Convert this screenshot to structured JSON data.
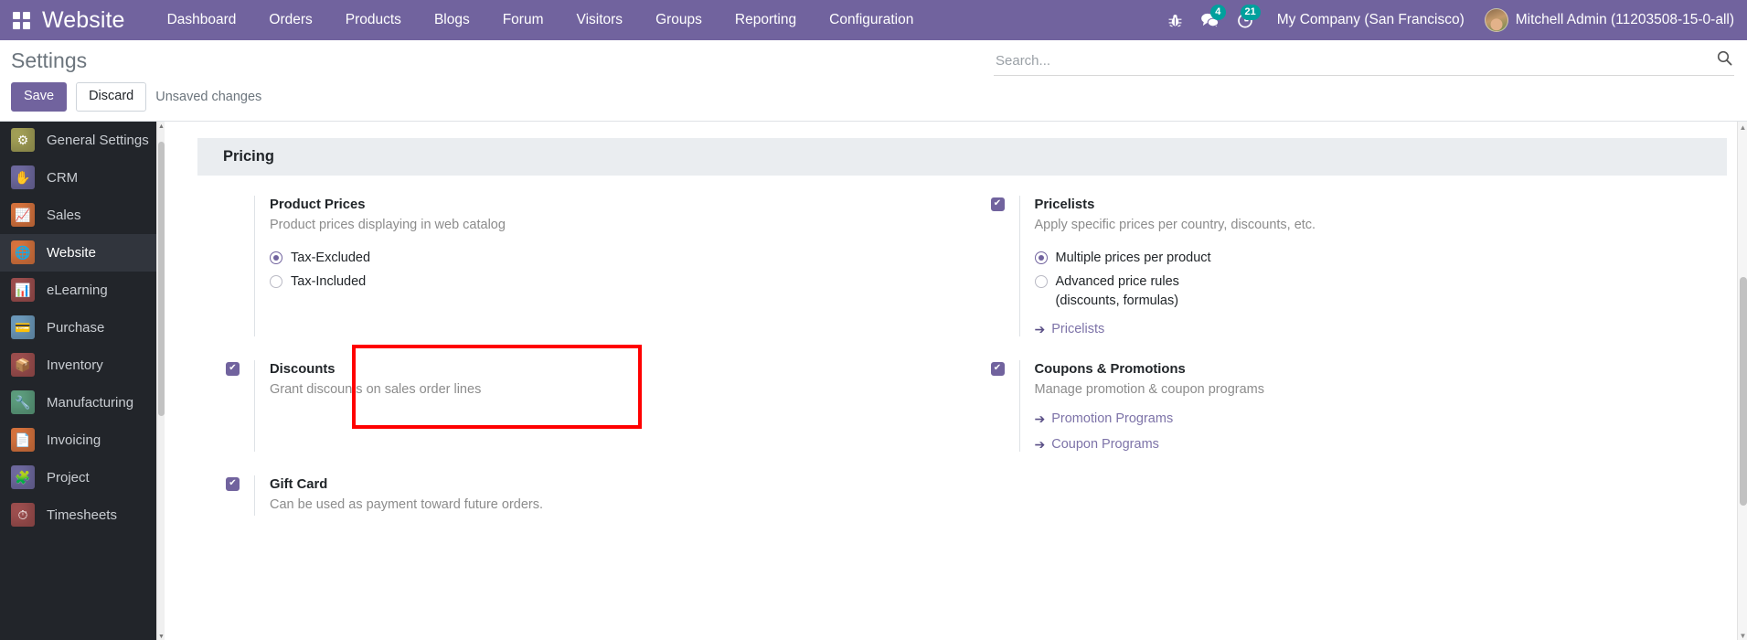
{
  "topbar": {
    "apps_icon": "apps-grid-icon",
    "brand": "Website",
    "menu": [
      {
        "label": "Dashboard"
      },
      {
        "label": "Orders"
      },
      {
        "label": "Products"
      },
      {
        "label": "Blogs"
      },
      {
        "label": "Forum"
      },
      {
        "label": "Visitors"
      },
      {
        "label": "Groups"
      },
      {
        "label": "Reporting"
      },
      {
        "label": "Configuration"
      }
    ],
    "sys_icons": [
      {
        "name": "bug-icon",
        "glyph": "🐞",
        "badge": ""
      },
      {
        "name": "messages-icon",
        "glyph": "💬",
        "badge": "4"
      },
      {
        "name": "activities-clock-icon",
        "glyph": "⏱",
        "badge": "21"
      }
    ],
    "company": "My Company (San Francisco)",
    "user": "Mitchell Admin (11203508-15-0-all)",
    "accent_color": "#71639e",
    "badge_color": "#00a09d"
  },
  "controlpanel": {
    "title": "Settings",
    "save_label": "Save",
    "discard_label": "Discard",
    "unsaved_label": "Unsaved changes",
    "search_placeholder": "Search...",
    "search_value": "",
    "search_icon": "search-icon"
  },
  "sidebar": {
    "items": [
      {
        "label": "General Settings",
        "icon": "gear-icon",
        "glyph": "⚙",
        "color": "#a3a057",
        "active": false
      },
      {
        "label": "CRM",
        "icon": "handshake-icon",
        "glyph": "✋",
        "color": "#6f6aa0",
        "active": false
      },
      {
        "label": "Sales",
        "icon": "chart-line-icon",
        "glyph": "📈",
        "color": "#d8743e",
        "active": false
      },
      {
        "label": "Website",
        "icon": "globe-icon",
        "glyph": "🌐",
        "color": "#d8743e",
        "active": true
      },
      {
        "label": "eLearning",
        "icon": "presentation-icon",
        "glyph": "📊",
        "color": "#9e4f4f",
        "active": false
      },
      {
        "label": "Purchase",
        "icon": "card-icon",
        "glyph": "💳",
        "color": "#6d9bbd",
        "active": false
      },
      {
        "label": "Inventory",
        "icon": "box-icon",
        "glyph": "📦",
        "color": "#9e4f4f",
        "active": false
      },
      {
        "label": "Manufacturing",
        "icon": "wrench-icon",
        "glyph": "🔧",
        "color": "#5d9e7e",
        "active": false
      },
      {
        "label": "Invoicing",
        "icon": "invoice-icon",
        "glyph": "📄",
        "color": "#d8743e",
        "active": false
      },
      {
        "label": "Project",
        "icon": "puzzle-icon",
        "glyph": "🧩",
        "color": "#6f6aa0",
        "active": false
      },
      {
        "label": "Timesheets",
        "icon": "stopwatch-icon",
        "glyph": "⏱",
        "color": "#9e4f4f",
        "active": false
      }
    ]
  },
  "main": {
    "section_title": "Pricing",
    "settings": [
      {
        "key": "product_prices",
        "title": "Product Prices",
        "description": "Product prices displaying in web catalog",
        "has_checkbox": false,
        "checked": false,
        "radios": [
          {
            "label": "Tax-Excluded",
            "checked": true
          },
          {
            "label": "Tax-Included",
            "checked": false
          }
        ],
        "links": []
      },
      {
        "key": "pricelists",
        "title": "Pricelists",
        "description": "Apply specific prices per country, discounts, etc.",
        "has_checkbox": true,
        "checked": true,
        "radios": [
          {
            "label": "Multiple prices per product",
            "checked": true
          },
          {
            "label": "Advanced price rules",
            "sub": "(discounts, formulas)",
            "checked": false
          }
        ],
        "links": [
          {
            "label": "Pricelists"
          }
        ]
      },
      {
        "key": "discounts",
        "title": "Discounts",
        "description": "Grant discounts on sales order lines",
        "has_checkbox": true,
        "checked": true,
        "radios": [],
        "links": [],
        "highlighted": true
      },
      {
        "key": "coupons_promotions",
        "title": "Coupons & Promotions",
        "description": "Manage promotion & coupon programs",
        "has_checkbox": true,
        "checked": true,
        "radios": [],
        "links": [
          {
            "label": "Promotion Programs"
          },
          {
            "label": "Coupon Programs"
          }
        ]
      },
      {
        "key": "gift_card",
        "title": "Gift Card",
        "description": "Can be used as payment toward future orders.",
        "has_checkbox": true,
        "checked": true,
        "radios": [],
        "links": []
      }
    ],
    "highlight_color": "#ff0000",
    "checkbox_color": "#71639e"
  }
}
